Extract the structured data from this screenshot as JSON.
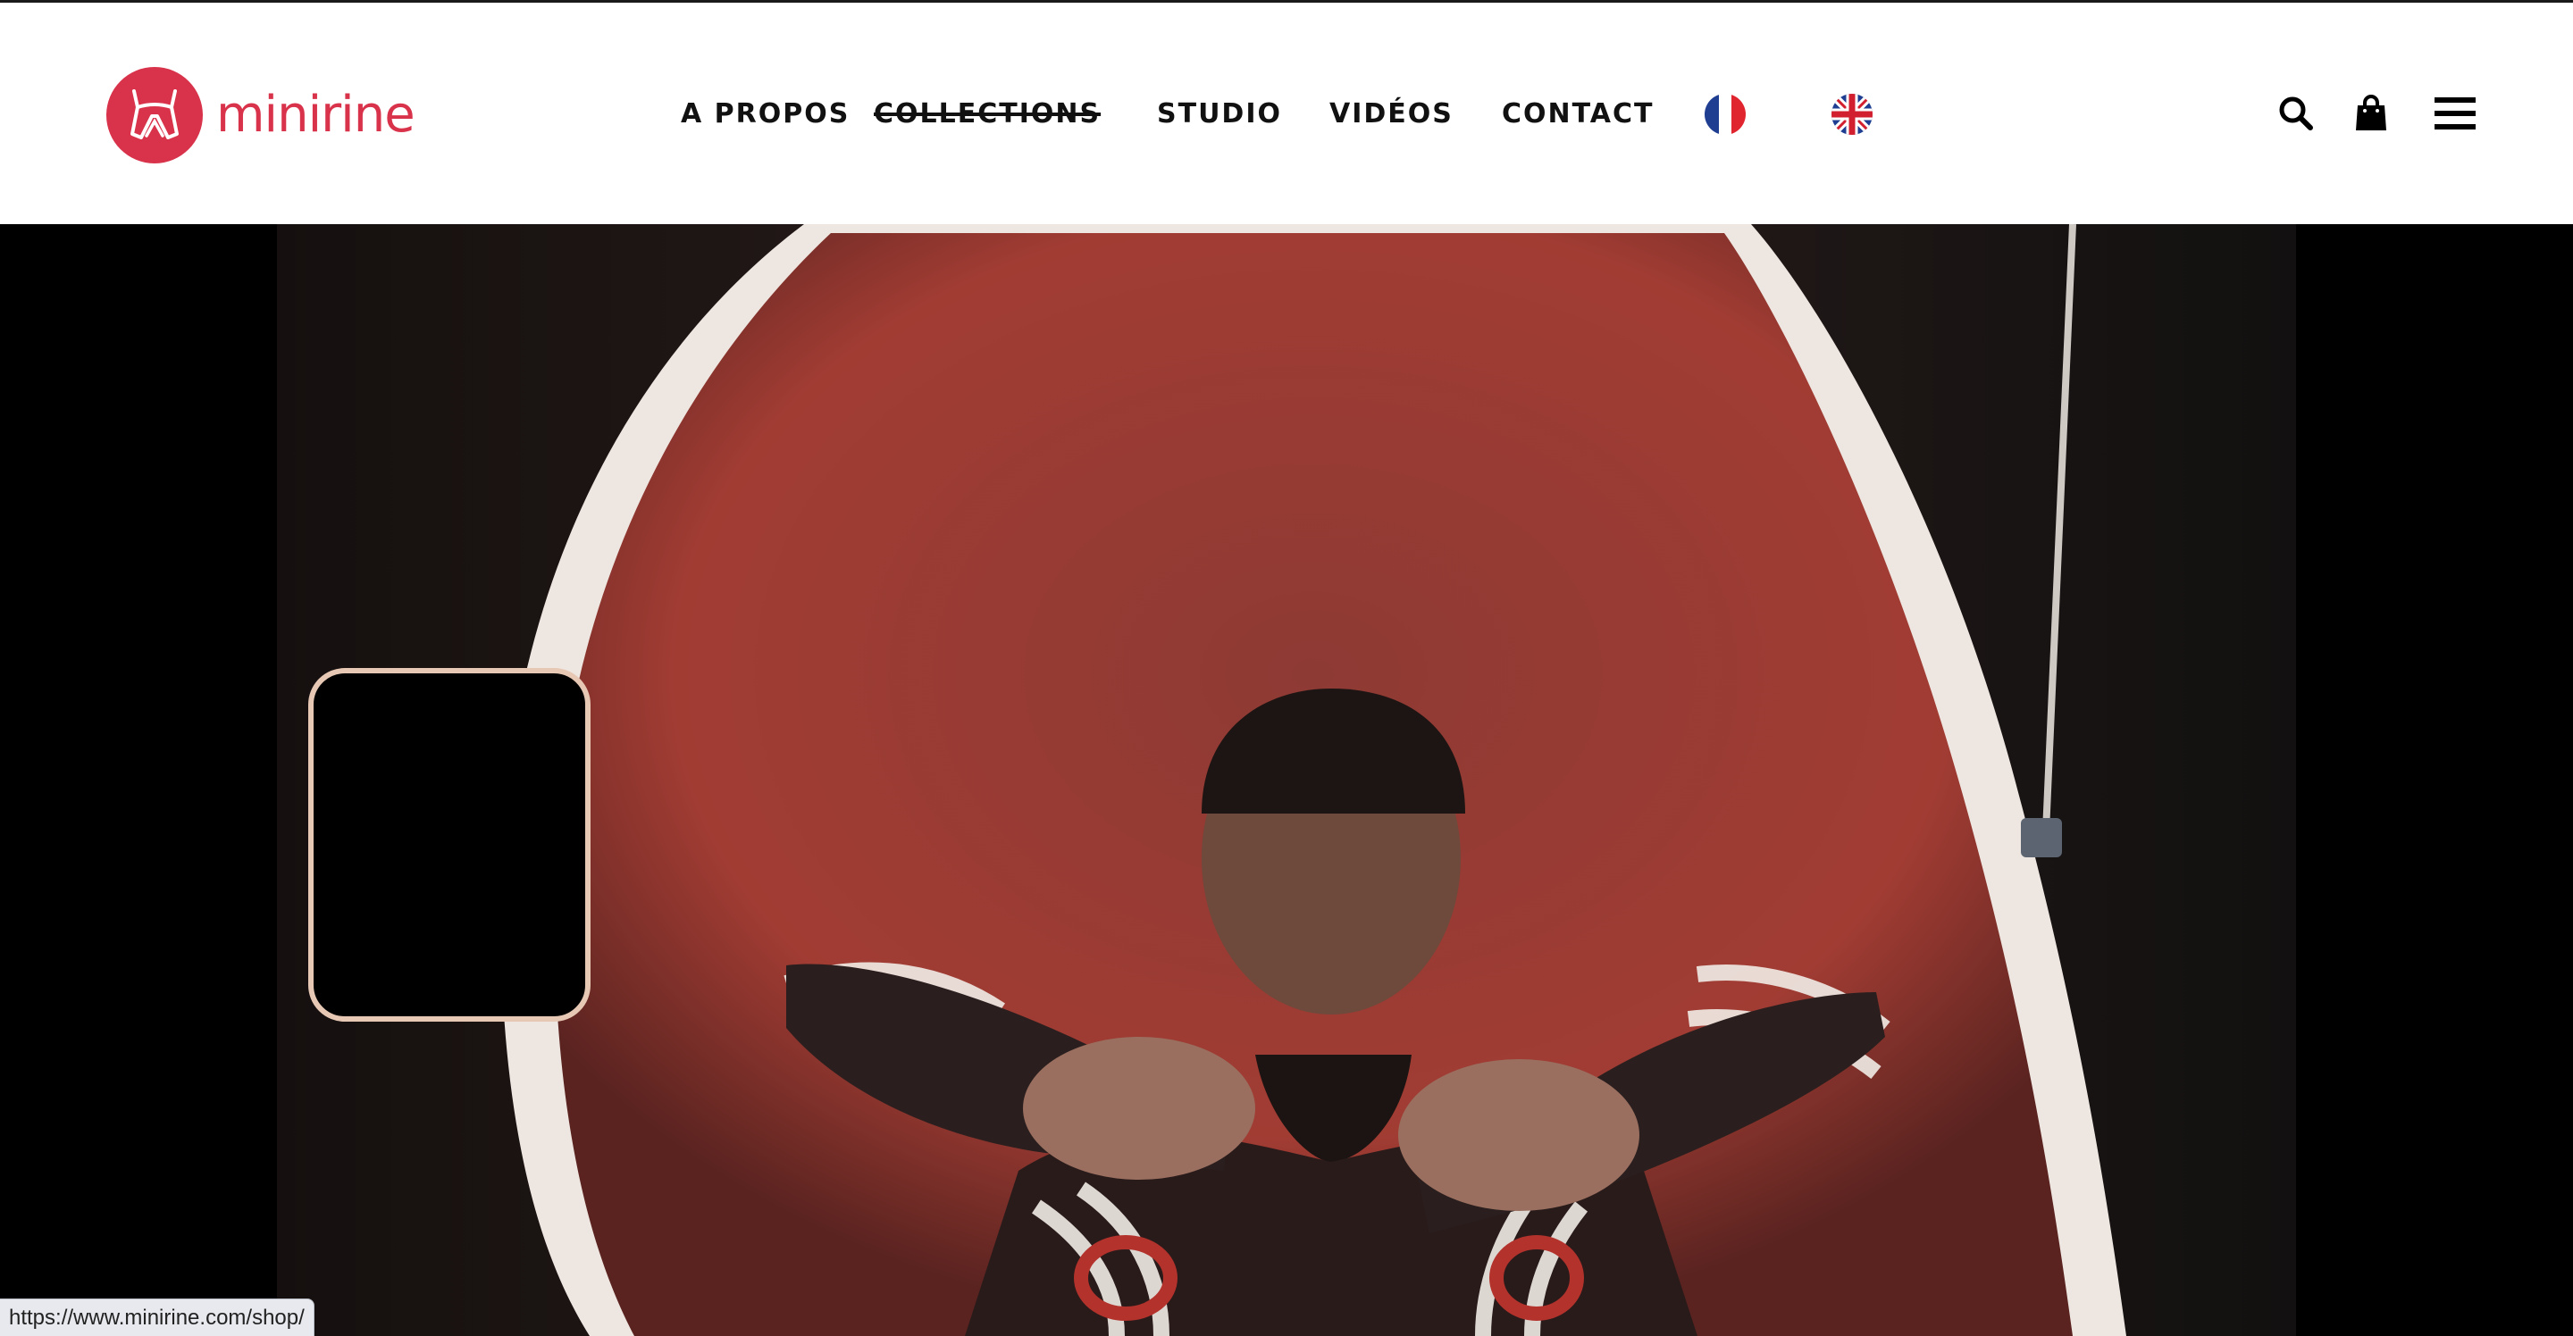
{
  "brand": {
    "name": "minirine",
    "color": "#d9334b"
  },
  "nav": {
    "items": [
      {
        "label": "A PROPOS"
      },
      {
        "label": "COLLECTIONS",
        "struck": true
      },
      {
        "label": "STUDIO"
      },
      {
        "label": "VIDÉOS"
      },
      {
        "label": "CONTACT"
      }
    ],
    "languages": [
      {
        "icon": "flag-france-icon"
      },
      {
        "icon": "flag-uk-icon"
      }
    ]
  },
  "header_icons": [
    "search-icon",
    "shopping-bag-icon",
    "menu-icon"
  ],
  "hero": {
    "type": "video-still"
  },
  "status_bar": {
    "url": "https://www.minirine.com/shop/"
  }
}
